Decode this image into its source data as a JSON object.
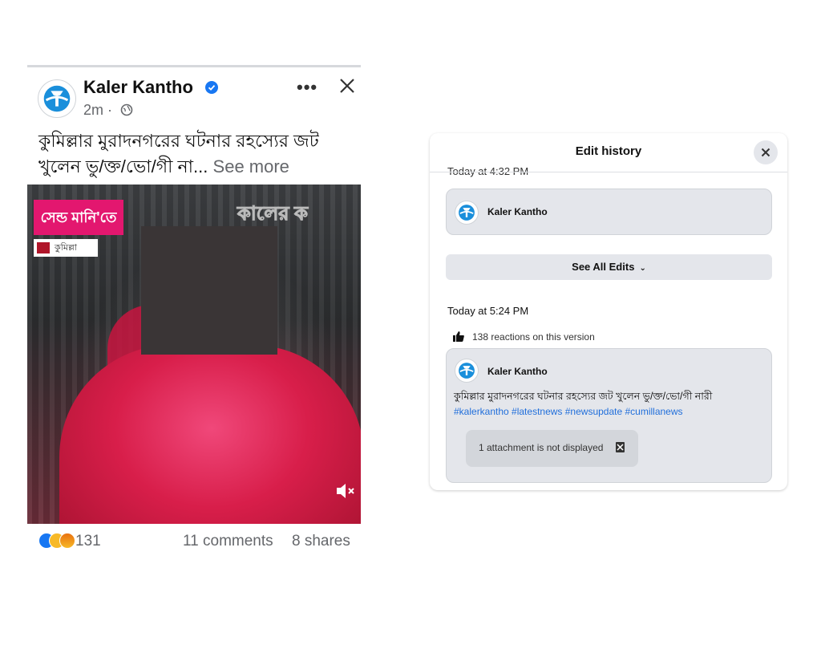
{
  "post": {
    "page_name": "Kaler Kantho",
    "time": "2m ·",
    "text": "কুমিল্লার মুরাদনগরের ঘটনার রহস্যের জট খুলেন ভু/ক্ত/ভো/গী না...",
    "see_more": "See more",
    "more_label": "•••",
    "media": {
      "red_tag": "সেন্ড মানি'তে",
      "location_tag": "কুমিল্লা",
      "watermark": "কালের ক"
    },
    "reactions_count": "131",
    "comments": "11 comments",
    "shares": "8 shares"
  },
  "dialog": {
    "title": "Edit history",
    "cut_time": "Today at 4:32 PM",
    "first_card": {
      "name": "Kaler Kantho"
    },
    "see_all_label": "See All Edits",
    "version_time": "Today at 5:24 PM",
    "version_reactions": "138 reactions on this version",
    "second_card": {
      "name": "Kaler Kantho",
      "text": "কুমিল্লার মুরাদনগরের ঘটনার রহস্যের জট খুলেন ভু/ক্ত/ভো/গী নারী",
      "hashtags": "#kalerkantho #latestnews #newsupdate #cumillanews",
      "attachment_note": "1 attachment is not displayed"
    }
  },
  "colors": {
    "facebook_blue": "#1877f2",
    "hashtag_blue": "#216fdb",
    "secondary_text": "#65676b",
    "card_bg": "#e4e6eb"
  }
}
